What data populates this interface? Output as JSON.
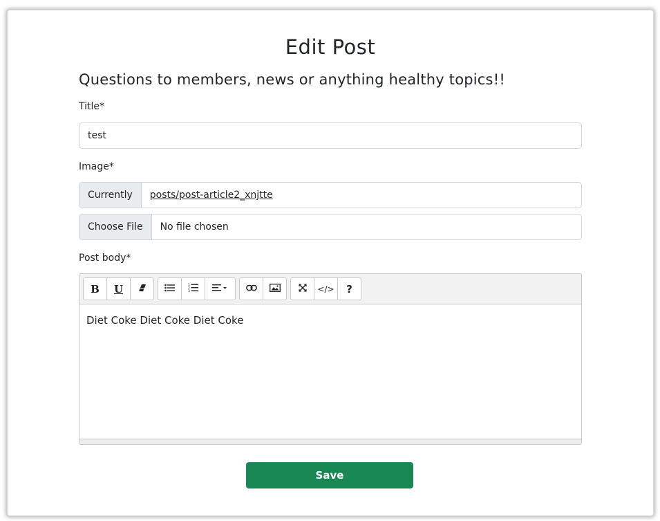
{
  "page": {
    "title": "Edit Post",
    "subtitle": "Questions to members, news or anything healthy topics!!"
  },
  "form": {
    "title_label": "Title*",
    "title_value": "test",
    "image_label": "Image*",
    "currently_label": "Currently",
    "current_image": "posts/post-article2_xnjtte",
    "choose_file_label": "Choose File",
    "file_status": "No file chosen",
    "body_label": "Post body*",
    "body_text": "Diet Coke Diet Coke Diet Coke",
    "save_label": "Save"
  },
  "toolbar": {
    "bold": "B",
    "underline": "U",
    "code_view": "</>",
    "help": "?",
    "icons": [
      "bold-icon",
      "underline-icon",
      "eraser-icon",
      "unordered-list-icon",
      "ordered-list-icon",
      "align-icon",
      "link-icon",
      "picture-icon",
      "fullscreen-icon",
      "code-view-icon",
      "help-icon"
    ]
  },
  "colors": {
    "save_button": "#198754",
    "input_border": "#ced4da",
    "addon_bg": "#e9ecef",
    "toolbar_bg": "#f2f2f2"
  }
}
